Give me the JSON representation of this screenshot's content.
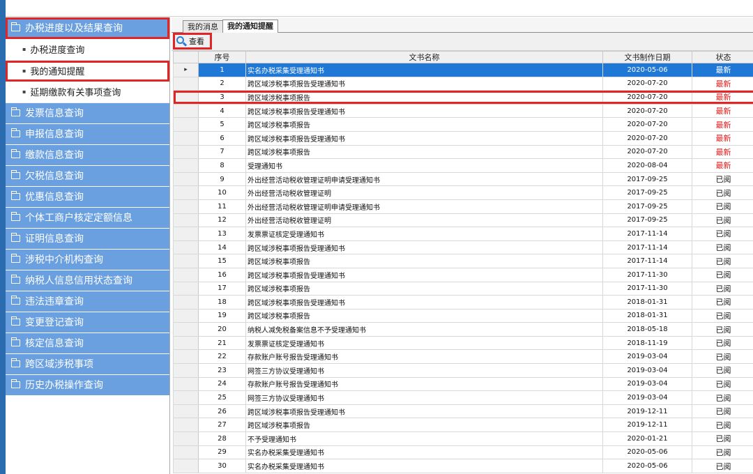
{
  "sidebar": {
    "groups": [
      {
        "label": "办税进度以及结果查询",
        "expanded": true,
        "highlighted": true,
        "items": [
          {
            "label": "办税进度查询",
            "highlighted": false
          },
          {
            "label": "我的通知提醒",
            "highlighted": true
          },
          {
            "label": "延期缴款有关事项查询",
            "highlighted": false
          }
        ]
      },
      {
        "label": "发票信息查询"
      },
      {
        "label": "申报信息查询"
      },
      {
        "label": "缴款信息查询"
      },
      {
        "label": "欠税信息查询"
      },
      {
        "label": "优惠信息查询"
      },
      {
        "label": "个体工商户核定定额信息"
      },
      {
        "label": "证明信息查询"
      },
      {
        "label": "涉税中介机构查询"
      },
      {
        "label": "纳税人信息信用状态查询"
      },
      {
        "label": "违法违章查询"
      },
      {
        "label": "变更登记查询"
      },
      {
        "label": "核定信息查询"
      },
      {
        "label": "跨区域涉税事项"
      },
      {
        "label": "历史办税操作查询"
      }
    ]
  },
  "tabs": [
    {
      "label": "我的消息",
      "active": false
    },
    {
      "label": "我的通知提醒",
      "active": true
    }
  ],
  "toolbar": {
    "view_label": "查看",
    "view_icon": "magnifier-icon"
  },
  "table": {
    "columns": [
      "序号",
      "文书名称",
      "文书制作日期",
      "状态"
    ],
    "selected_row": 1,
    "highlighted_row": 3,
    "colors": {
      "selected_bg": "#1f78d6",
      "status_new": "#e01b1b",
      "highlight": "#e32424"
    },
    "rows": [
      {
        "seq": "1",
        "name": "实名办税采集受理通知书",
        "date": "2020-05-06",
        "status": "最新"
      },
      {
        "seq": "2",
        "name": "跨区域涉税事项报告受理通知书",
        "date": "2020-07-20",
        "status": "最新"
      },
      {
        "seq": "3",
        "name": "跨区域涉税事项报告",
        "date": "2020-07-20",
        "status": "最新"
      },
      {
        "seq": "4",
        "name": "跨区域涉税事项报告受理通知书",
        "date": "2020-07-20",
        "status": "最新"
      },
      {
        "seq": "5",
        "name": "跨区域涉税事项报告",
        "date": "2020-07-20",
        "status": "最新"
      },
      {
        "seq": "6",
        "name": "跨区域涉税事项报告受理通知书",
        "date": "2020-07-20",
        "status": "最新"
      },
      {
        "seq": "7",
        "name": "跨区域涉税事项报告",
        "date": "2020-07-20",
        "status": "最新"
      },
      {
        "seq": "8",
        "name": "受理通知书",
        "date": "2020-08-04",
        "status": "最新"
      },
      {
        "seq": "9",
        "name": "外出经营活动税收管理证明申请受理通知书",
        "date": "2017-09-25",
        "status": "已阅"
      },
      {
        "seq": "10",
        "name": "外出经营活动税收管理证明",
        "date": "2017-09-25",
        "status": "已阅"
      },
      {
        "seq": "11",
        "name": "外出经营活动税收管理证明申请受理通知书",
        "date": "2017-09-25",
        "status": "已阅"
      },
      {
        "seq": "12",
        "name": "外出经营活动税收管理证明",
        "date": "2017-09-25",
        "status": "已阅"
      },
      {
        "seq": "13",
        "name": "发票票证核定受理通知书",
        "date": "2017-11-14",
        "status": "已阅"
      },
      {
        "seq": "14",
        "name": "跨区域涉税事项报告受理通知书",
        "date": "2017-11-14",
        "status": "已阅"
      },
      {
        "seq": "15",
        "name": "跨区域涉税事项报告",
        "date": "2017-11-14",
        "status": "已阅"
      },
      {
        "seq": "16",
        "name": "跨区域涉税事项报告受理通知书",
        "date": "2017-11-30",
        "status": "已阅"
      },
      {
        "seq": "17",
        "name": "跨区域涉税事项报告",
        "date": "2017-11-30",
        "status": "已阅"
      },
      {
        "seq": "18",
        "name": "跨区域涉税事项报告受理通知书",
        "date": "2018-01-31",
        "status": "已阅"
      },
      {
        "seq": "19",
        "name": "跨区域涉税事项报告",
        "date": "2018-01-31",
        "status": "已阅"
      },
      {
        "seq": "20",
        "name": "纳税人减免税备案信息不予受理通知书",
        "date": "2018-05-18",
        "status": "已阅"
      },
      {
        "seq": "21",
        "name": "发票票证核定受理通知书",
        "date": "2018-11-19",
        "status": "已阅"
      },
      {
        "seq": "22",
        "name": "存款账户账号报告受理通知书",
        "date": "2019-03-04",
        "status": "已阅"
      },
      {
        "seq": "23",
        "name": "网签三方协议受理通知书",
        "date": "2019-03-04",
        "status": "已阅"
      },
      {
        "seq": "24",
        "name": "存款账户账号报告受理通知书",
        "date": "2019-03-04",
        "status": "已阅"
      },
      {
        "seq": "25",
        "name": "网签三方协议受理通知书",
        "date": "2019-03-04",
        "status": "已阅"
      },
      {
        "seq": "26",
        "name": "跨区域涉税事项报告受理通知书",
        "date": "2019-12-11",
        "status": "已阅"
      },
      {
        "seq": "27",
        "name": "跨区域涉税事项报告",
        "date": "2019-12-11",
        "status": "已阅"
      },
      {
        "seq": "28",
        "name": "不予受理通知书",
        "date": "2020-01-21",
        "status": "已阅"
      },
      {
        "seq": "29",
        "name": "实名办税采集受理通知书",
        "date": "2020-05-06",
        "status": "已阅"
      },
      {
        "seq": "30",
        "name": "实名办税采集受理通知书",
        "date": "2020-05-06",
        "status": "已阅"
      }
    ]
  }
}
